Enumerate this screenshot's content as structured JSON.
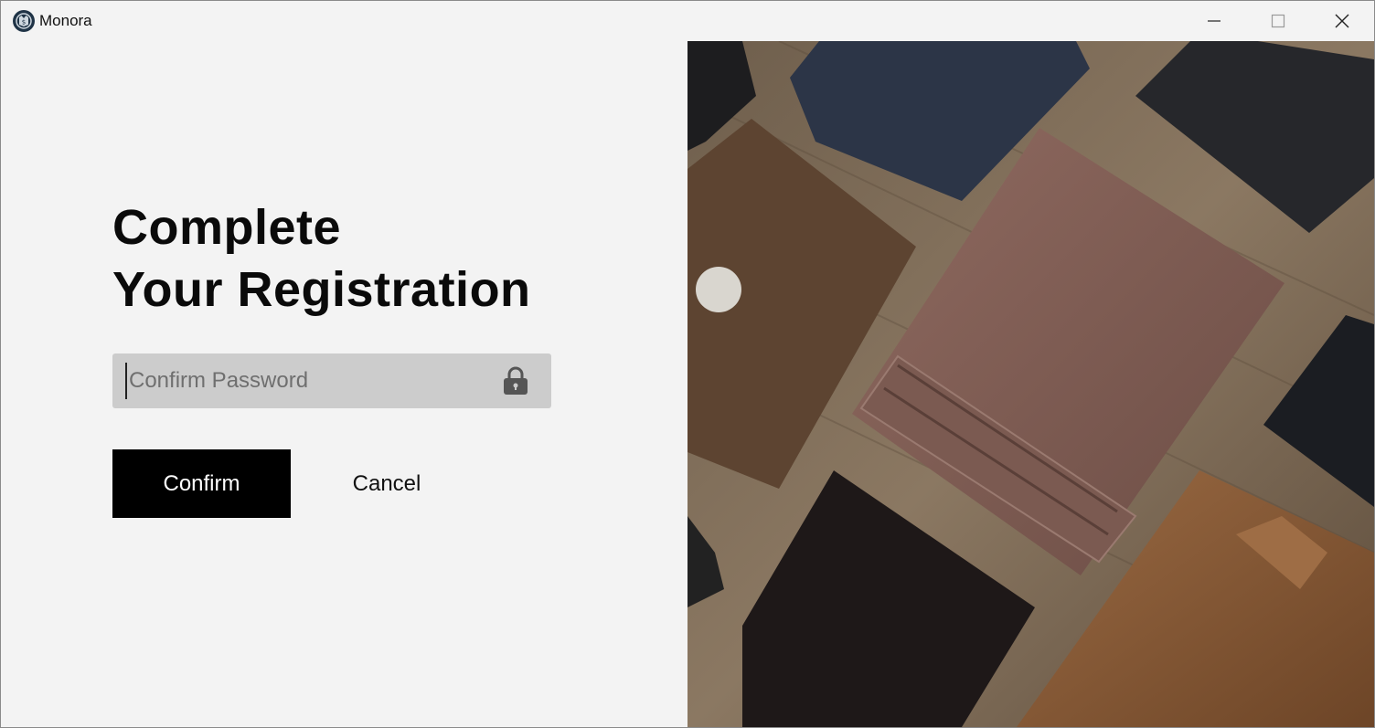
{
  "window": {
    "title": "Monora",
    "icon": "monora-logo-icon",
    "controls": [
      "minimize-icon",
      "maximize-icon",
      "close-icon"
    ]
  },
  "form": {
    "heading_line1": "Complete",
    "heading_line2": "Your Registration",
    "password_placeholder": "Confirm Password",
    "password_value": "",
    "password_icon": "lock-icon",
    "confirm_label": "Confirm",
    "cancel_label": "Cancel"
  },
  "colors": {
    "background": "#f3f3f3",
    "field": "#cccccc",
    "primary_button": "#000000",
    "primary_text": "#ffffff"
  },
  "photo": {
    "subject": "leather-wallets-photo"
  }
}
